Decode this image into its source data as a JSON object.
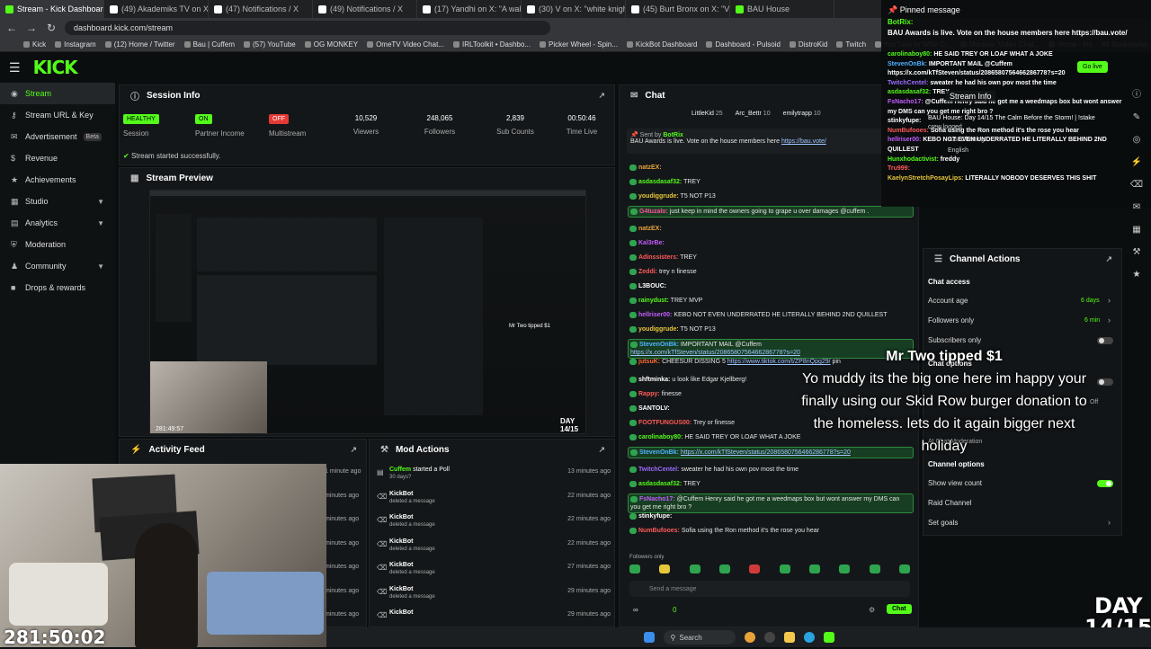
{
  "browser": {
    "tabs": [
      "Stream - Kick Dashboard",
      "(49) Akademiks TV on X: \"Alab",
      "(47) Notifications / X",
      "(49) Notifications / X",
      "(17) Yandhi on X: \"A walking pi",
      "(30) V on X: \"white knight",
      "(45) Burt Bronx on X: \"VOTE B",
      "BAU House"
    ],
    "url": "dashboard.kick.com/stream",
    "bookmarks": [
      "Kick",
      "Instagram",
      "(12) Home / Twitter",
      "Bau | Cuffem",
      "(57) YouTube",
      "OG MONKEY",
      "OmeTV Video Chat...",
      "IRLToolkit • Dashbo...",
      "Picker Wheel - Spin...",
      "KickBot Dashboard",
      "Dashboard - Pulsoid",
      "DistroKid",
      "Twitch",
      "YouTube to WAV D...",
      "Monkey: Video Chat...",
      "Home - Ro"
    ],
    "all_bookmarks": "All Bookmarks"
  },
  "brand": {
    "logo": "KICK",
    "accent": "#53fc18"
  },
  "sidebar": {
    "items": [
      {
        "label": "Stream",
        "icon": "radio-icon",
        "active": true
      },
      {
        "label": "Stream URL & Key",
        "icon": "key-icon"
      },
      {
        "label": "Advertisement",
        "icon": "megaphone-icon",
        "badge": "Beta"
      },
      {
        "label": "Revenue",
        "icon": "dollar-icon"
      },
      {
        "label": "Achievements",
        "icon": "trophy-icon"
      },
      {
        "label": "Studio",
        "icon": "studio-icon",
        "chevron": true
      },
      {
        "label": "Analytics",
        "icon": "chart-icon",
        "chevron": true
      },
      {
        "label": "Moderation",
        "icon": "shield-icon"
      },
      {
        "label": "Community",
        "icon": "users-icon",
        "chevron": true
      },
      {
        "label": "Drops & rewards",
        "icon": "gift-icon"
      }
    ]
  },
  "session": {
    "title": "Session Info",
    "stats": [
      {
        "value": "HEALTHY",
        "label": "Session",
        "badge_color": "#53fc18"
      },
      {
        "value": "ON",
        "label": "Partner Income",
        "badge_color": "#53fc18"
      },
      {
        "value": "OFF",
        "label": "Multistream",
        "badge_color": "#e53935"
      },
      {
        "value": "10,529",
        "label": "Viewers"
      },
      {
        "value": "248,065",
        "label": "Followers"
      },
      {
        "value": "2,839",
        "label": "Sub Counts"
      },
      {
        "value": "00:50:46",
        "label": "Time Live"
      }
    ],
    "status": "Stream started successfully."
  },
  "preview": {
    "title": "Stream Preview",
    "timestamp": "281:49:57",
    "tip_title": "Mr Two tipped $1",
    "day": "DAY 14/15"
  },
  "activity": {
    "title": "Activity Feed",
    "times": [
      "1 minute ago",
      "minutes ago",
      "minutes ago",
      "minutes ago",
      "minutes ago",
      "minutes ago",
      "minutes ago"
    ]
  },
  "mod_actions": {
    "title": "Mod Actions",
    "rows": [
      {
        "user": "Cuffem",
        "action": "started a Poll",
        "detail": "30 days?",
        "time": "13 minutes ago"
      },
      {
        "user": "KickBot",
        "detail": "deleted a message",
        "time": "22 minutes ago"
      },
      {
        "user": "KickBot",
        "detail": "deleted a message",
        "time": "22 minutes ago"
      },
      {
        "user": "KickBot",
        "detail": "deleted a message",
        "time": "22 minutes ago"
      },
      {
        "user": "KickBot",
        "detail": "deleted a message",
        "time": "27 minutes ago"
      },
      {
        "user": "KickBot",
        "detail": "deleted a message",
        "time": "29 minutes ago"
      },
      {
        "user": "KickBot",
        "detail": "",
        "time": "29 minutes ago"
      }
    ]
  },
  "chat": {
    "title": "Chat",
    "top_gifters": [
      {
        "name": "LittleKid",
        "count": "25"
      },
      {
        "name": "Arc_Bettr",
        "count": "10"
      },
      {
        "name": "emilytrapp",
        "count": "10"
      }
    ],
    "pinned_by": "Sent by",
    "pinned_user": "BotRix",
    "pinned_text": "BAU Awards is live. Vote on the house members here",
    "pinned_link": "https://bau.vote/",
    "messages": [
      {
        "user": "natzEX:",
        "text": "",
        "color": "#e8a23a"
      },
      {
        "user": "asdasdasaf32:",
        "text": "TREY",
        "color": "#53fc18"
      },
      {
        "user": "youdiggrude:",
        "text": "T5 NOT P13",
        "color": "#e6c63a"
      },
      {
        "user": "G4tuzalo:",
        "text": "just keep in mind the owners going to grape u over damages @cuffem .",
        "color": "#ff4fa0",
        "hl": true
      },
      {
        "user": "natzEX:",
        "text": "",
        "color": "#e8a23a"
      },
      {
        "user": "Kal3rBe:",
        "text": "",
        "color": "#c45cff"
      },
      {
        "user": "Adinssisters:",
        "text": "TREY",
        "color": "#ff5a5a"
      },
      {
        "user": "Zeddi:",
        "text": "trey n finesse",
        "color": "#ff5a5a"
      },
      {
        "user": "L3BOUC:",
        "text": "",
        "color": "#fff"
      },
      {
        "user": "rainydust:",
        "text": "TREY MVP",
        "color": "#53fc18"
      },
      {
        "user": "hellriser00:",
        "text": "KEBO NOT EVEN UNDERRATED HE LITERALLY BEHIND 2ND QUILLEST",
        "color": "#c45cff"
      },
      {
        "user": "youdiggrude:",
        "text": "T5 NOT P13",
        "color": "#e6c63a"
      },
      {
        "user": "StevenOnBk:",
        "text": "IMPORTANT MAIL",
        "color": "#4fb2ff",
        "hl": true,
        "mention": "@Cuffem",
        "link": "https://x.com/kTfSteven/status/2086580756466286778?s=20"
      },
      {
        "user": "jutsuK:",
        "text": "CHEESUR DISSING 5",
        "color": "#ff6a2e",
        "link": "https://www.tiktok.com/t/ZP8nQpg29/",
        "tail": "pin"
      },
      {
        "user": "shftminka:",
        "text": "u look like Edgar Kjellberg!",
        "color": "#fff"
      },
      {
        "user": "Rappy:",
        "text": "finesse",
        "color": "#ff5a5a"
      },
      {
        "user": "SANTOLV:",
        "text": "",
        "color": "#fff"
      },
      {
        "user": "FOOTFUNGUS00:",
        "text": "Trey or finesse",
        "color": "#ff5a5a"
      },
      {
        "user": "carolinaboy80:",
        "text": "HE SAID TREY OR LOAF",
        "tail": "WHAT A JOKE",
        "color": "#53fc18"
      },
      {
        "user": "StevenOnBk:",
        "text": "",
        "color": "#4fb2ff",
        "hl": true,
        "link": "https://x.com/kTfSteven/status/2086580756466286778?s=20"
      },
      {
        "user": "TwitchCentel:",
        "text": "sweater he had his own pov most the time",
        "color": "#9a6bff"
      },
      {
        "user": "asdasdasaf32:",
        "text": "TREY",
        "color": "#53fc18"
      },
      {
        "user": "FsNacho17:",
        "text": "@Cuffem Henry said he got me a weedmaps box but wont answer my DMS can you get me right bro ?",
        "color": "#c45cff",
        "hl": true
      },
      {
        "user": "stinkyfupe:",
        "text": "",
        "color": "#fff"
      },
      {
        "user": "NumBufooes:",
        "text": "Sofia using the Ron method it's the rose you hear",
        "color": "#ff5a5a"
      }
    ],
    "followers_only": "Followers only",
    "input_placeholder": "Send a message",
    "count": "0",
    "send_label": "Chat"
  },
  "pinned_overlay": {
    "title": "Pinned message",
    "bot": "BotRix:",
    "text": "BAU Awards is live. Vote on the house members here https://bau.vote/",
    "lines": [
      {
        "user": "carolinaboy80:",
        "text": "HE SAID TREY OR LOAF",
        "tail": "WHAT A JOKE",
        "color": "#53fc18"
      },
      {
        "user": "StevenOnBk:",
        "text": "IMPORTANT MAIL",
        "mention": "@Cuffem",
        "color": "#4fb2ff"
      },
      {
        "user": "",
        "text": "https://x.com/kTfSteven/status/2086580756466286778?s=20",
        "color": "#fff"
      },
      {
        "user": "TwitchCentel:",
        "text": "sweater he had his own pov most the time",
        "color": "#9a6bff"
      },
      {
        "user": "asdasdasaf32:",
        "text": "TREY",
        "color": "#53fc18"
      },
      {
        "user": "FsNacho17:",
        "text": "@Cuffem Henry said he got me a weedmaps box but wont answer",
        "color": "#c45cff"
      },
      {
        "user": "",
        "text": "my DMS can you get me right bro ?",
        "color": "#fff"
      },
      {
        "user": "stinkyfupe:",
        "text": "",
        "color": "#fff"
      },
      {
        "user": "NumBufooes:",
        "text": "Sofia using the Ron method it's the rose you hear",
        "color": "#ff5a5a"
      },
      {
        "user": "hellriser00:",
        "text": "KEBO NOT EVEN UNDERRATED HE LITERALLY BEHIND 2ND",
        "color": "#c45cff"
      },
      {
        "user": "",
        "text": "QUILLEST",
        "color": "#fff"
      },
      {
        "user": "Hunxhodactivist:",
        "text": "freddy",
        "color": "#53fc18"
      },
      {
        "user": "Tru999:",
        "text": "",
        "color": "#ff5a5a"
      },
      {
        "user": "KaelynStretchPosayLips:",
        "text": "LITERALLY NOBODY DESERVES THIS SHIT",
        "color": "#e6c63a"
      }
    ],
    "stream_info": "Stream Info",
    "go_live": "Go live",
    "house_line": "BAU House: Day 14/15 The Calm Before the Storm! | !stake",
    "crew_logged": "crew logged",
    "just_chatting": "Just Chatting",
    "english": "English"
  },
  "channel_actions": {
    "title": "Channel Actions",
    "chat_access": "Chat access",
    "account_age": "Account age",
    "account_age_value": "6 days",
    "followers_only": "Followers only",
    "followers_only_value": "6 min",
    "subscribers_only": "Subscribers only",
    "chat_options": "Chat options",
    "off": "Off",
    "ai_moderation": "AI Chat Moderation",
    "channel_options": "Channel options",
    "show_view_count": "Show view count",
    "raid_channel": "Raid Channel",
    "set_goals": "Set goals"
  },
  "tip": {
    "title": "Mr Two tipped $1",
    "message": "Yo muddy its the big one here im happy your finally using our Skid Row burger donation to the homeless. lets do it again bigger next holiday"
  },
  "overlay_timer": "281:50:02",
  "overlay_day": [
    "DAY",
    "14/15"
  ],
  "taskbar": {
    "search": "Search"
  }
}
